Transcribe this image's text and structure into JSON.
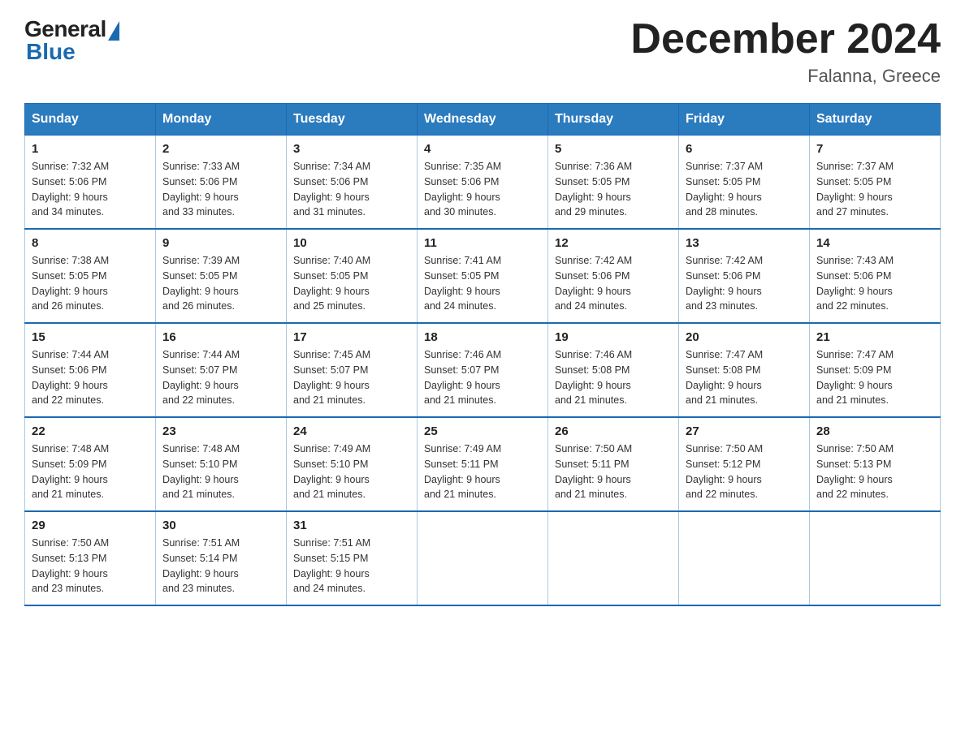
{
  "header": {
    "logo_general": "General",
    "logo_blue": "Blue",
    "title": "December 2024",
    "location": "Falanna, Greece"
  },
  "weekdays": [
    "Sunday",
    "Monday",
    "Tuesday",
    "Wednesday",
    "Thursday",
    "Friday",
    "Saturday"
  ],
  "weeks": [
    [
      {
        "day": "1",
        "sunrise": "7:32 AM",
        "sunset": "5:06 PM",
        "daylight": "9 hours and 34 minutes."
      },
      {
        "day": "2",
        "sunrise": "7:33 AM",
        "sunset": "5:06 PM",
        "daylight": "9 hours and 33 minutes."
      },
      {
        "day": "3",
        "sunrise": "7:34 AM",
        "sunset": "5:06 PM",
        "daylight": "9 hours and 31 minutes."
      },
      {
        "day": "4",
        "sunrise": "7:35 AM",
        "sunset": "5:06 PM",
        "daylight": "9 hours and 30 minutes."
      },
      {
        "day": "5",
        "sunrise": "7:36 AM",
        "sunset": "5:05 PM",
        "daylight": "9 hours and 29 minutes."
      },
      {
        "day": "6",
        "sunrise": "7:37 AM",
        "sunset": "5:05 PM",
        "daylight": "9 hours and 28 minutes."
      },
      {
        "day": "7",
        "sunrise": "7:37 AM",
        "sunset": "5:05 PM",
        "daylight": "9 hours and 27 minutes."
      }
    ],
    [
      {
        "day": "8",
        "sunrise": "7:38 AM",
        "sunset": "5:05 PM",
        "daylight": "9 hours and 26 minutes."
      },
      {
        "day": "9",
        "sunrise": "7:39 AM",
        "sunset": "5:05 PM",
        "daylight": "9 hours and 26 minutes."
      },
      {
        "day": "10",
        "sunrise": "7:40 AM",
        "sunset": "5:05 PM",
        "daylight": "9 hours and 25 minutes."
      },
      {
        "day": "11",
        "sunrise": "7:41 AM",
        "sunset": "5:05 PM",
        "daylight": "9 hours and 24 minutes."
      },
      {
        "day": "12",
        "sunrise": "7:42 AM",
        "sunset": "5:06 PM",
        "daylight": "9 hours and 24 minutes."
      },
      {
        "day": "13",
        "sunrise": "7:42 AM",
        "sunset": "5:06 PM",
        "daylight": "9 hours and 23 minutes."
      },
      {
        "day": "14",
        "sunrise": "7:43 AM",
        "sunset": "5:06 PM",
        "daylight": "9 hours and 22 minutes."
      }
    ],
    [
      {
        "day": "15",
        "sunrise": "7:44 AM",
        "sunset": "5:06 PM",
        "daylight": "9 hours and 22 minutes."
      },
      {
        "day": "16",
        "sunrise": "7:44 AM",
        "sunset": "5:07 PM",
        "daylight": "9 hours and 22 minutes."
      },
      {
        "day": "17",
        "sunrise": "7:45 AM",
        "sunset": "5:07 PM",
        "daylight": "9 hours and 21 minutes."
      },
      {
        "day": "18",
        "sunrise": "7:46 AM",
        "sunset": "5:07 PM",
        "daylight": "9 hours and 21 minutes."
      },
      {
        "day": "19",
        "sunrise": "7:46 AM",
        "sunset": "5:08 PM",
        "daylight": "9 hours and 21 minutes."
      },
      {
        "day": "20",
        "sunrise": "7:47 AM",
        "sunset": "5:08 PM",
        "daylight": "9 hours and 21 minutes."
      },
      {
        "day": "21",
        "sunrise": "7:47 AM",
        "sunset": "5:09 PM",
        "daylight": "9 hours and 21 minutes."
      }
    ],
    [
      {
        "day": "22",
        "sunrise": "7:48 AM",
        "sunset": "5:09 PM",
        "daylight": "9 hours and 21 minutes."
      },
      {
        "day": "23",
        "sunrise": "7:48 AM",
        "sunset": "5:10 PM",
        "daylight": "9 hours and 21 minutes."
      },
      {
        "day": "24",
        "sunrise": "7:49 AM",
        "sunset": "5:10 PM",
        "daylight": "9 hours and 21 minutes."
      },
      {
        "day": "25",
        "sunrise": "7:49 AM",
        "sunset": "5:11 PM",
        "daylight": "9 hours and 21 minutes."
      },
      {
        "day": "26",
        "sunrise": "7:50 AM",
        "sunset": "5:11 PM",
        "daylight": "9 hours and 21 minutes."
      },
      {
        "day": "27",
        "sunrise": "7:50 AM",
        "sunset": "5:12 PM",
        "daylight": "9 hours and 22 minutes."
      },
      {
        "day": "28",
        "sunrise": "7:50 AM",
        "sunset": "5:13 PM",
        "daylight": "9 hours and 22 minutes."
      }
    ],
    [
      {
        "day": "29",
        "sunrise": "7:50 AM",
        "sunset": "5:13 PM",
        "daylight": "9 hours and 23 minutes."
      },
      {
        "day": "30",
        "sunrise": "7:51 AM",
        "sunset": "5:14 PM",
        "daylight": "9 hours and 23 minutes."
      },
      {
        "day": "31",
        "sunrise": "7:51 AM",
        "sunset": "5:15 PM",
        "daylight": "9 hours and 24 minutes."
      },
      null,
      null,
      null,
      null
    ]
  ]
}
